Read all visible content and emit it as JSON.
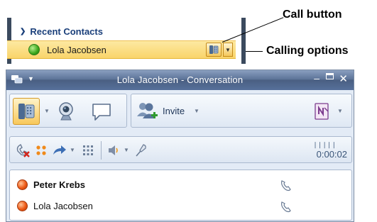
{
  "contacts_panel": {
    "group_header": "Recent Contacts",
    "contact_name": "Lola Jacobsen"
  },
  "callouts": {
    "call_button": "Call button",
    "calling_options": "Calling options"
  },
  "conversation_window": {
    "title": "Lola Jacobsen - Conversation",
    "invite_label": "Invite",
    "timer": "0:00:02",
    "participants": [
      {
        "name": "Peter Krebs",
        "bold": true
      },
      {
        "name": "Lola Jacobsen",
        "bold": false
      }
    ]
  },
  "colors": {
    "accent": "#f8c85b",
    "window_title_bar": "#5d7499",
    "available": "#3aa51b",
    "busy": "#ee5a16"
  }
}
